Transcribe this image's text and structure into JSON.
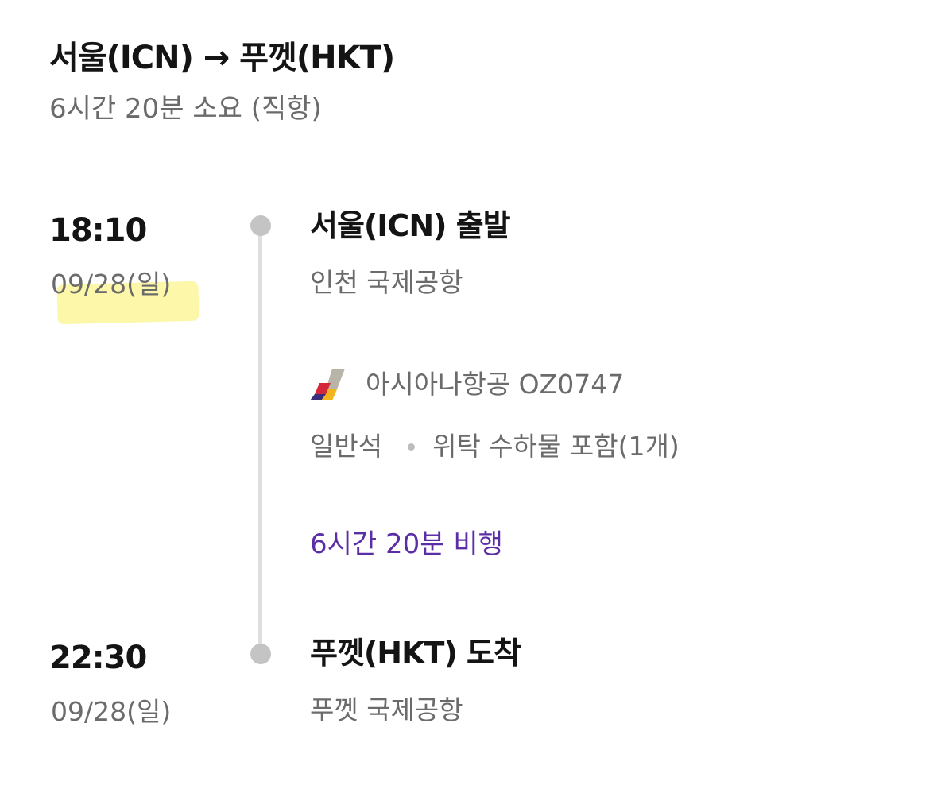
{
  "header": {
    "route": "서울(ICN) → 푸껫(HKT)",
    "summary": "6시간 20분 소요 (직항)"
  },
  "departure": {
    "time": "18:10",
    "date": "09/28(일)",
    "place": "서울(ICN) 출발",
    "airport": "인천 국제공항"
  },
  "flight": {
    "airline_logo_icon": "asiana-airlines-logo-icon",
    "airline": "아시아나항공 OZ0747",
    "cabin": "일반석",
    "baggage": "위탁 수하물 포함(1개)",
    "duration": "6시간 20분 비행",
    "duration_color": "#5b2ea6"
  },
  "arrival": {
    "time": "22:30",
    "date": "09/28(일)",
    "place": "푸껫(HKT) 도착",
    "airport": "푸껫 국제공항"
  },
  "colors": {
    "text_primary": "#141414",
    "text_secondary": "#6b6b6b",
    "timeline": "#dedede",
    "timeline_dot": "#c4c4c4",
    "highlight": "#fdf79a"
  }
}
